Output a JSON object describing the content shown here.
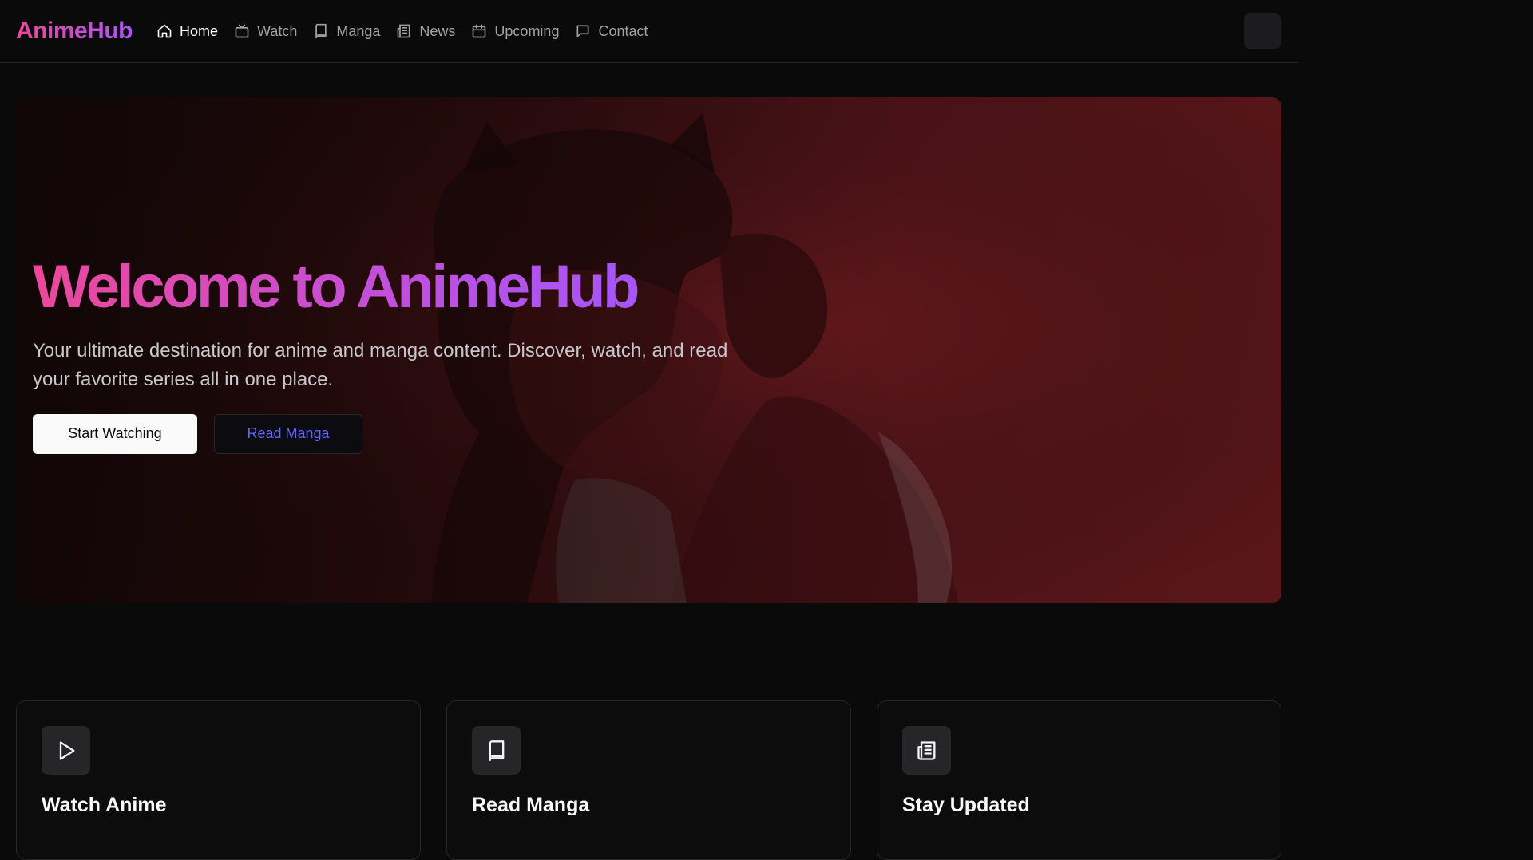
{
  "app": {
    "logo": "AnimeHub"
  },
  "nav": {
    "items": [
      {
        "label": "Home",
        "icon": "home-icon",
        "active": true
      },
      {
        "label": "Watch",
        "icon": "tv-icon"
      },
      {
        "label": "Manga",
        "icon": "book-icon"
      },
      {
        "label": "News",
        "icon": "newspaper-icon"
      },
      {
        "label": "Upcoming",
        "icon": "calendar-icon"
      },
      {
        "label": "Contact",
        "icon": "message-icon"
      }
    ]
  },
  "hero": {
    "title": "Welcome to AnimeHub",
    "subtitle": "Your ultimate destination for anime and manga content. Discover, watch, and read your favorite series all in one place.",
    "primary_button": "Start Watching",
    "secondary_button": "Read Manga"
  },
  "features": [
    {
      "title": "Watch Anime",
      "icon": "play-icon"
    },
    {
      "title": "Read Manga",
      "icon": "book-icon"
    },
    {
      "title": "Stay Updated",
      "icon": "newspaper-icon"
    }
  ],
  "colors": {
    "background": "#0a0a0a",
    "accent_pink": "#ec4899",
    "accent_purple": "#a855f7",
    "link_indigo": "#6366f1"
  }
}
